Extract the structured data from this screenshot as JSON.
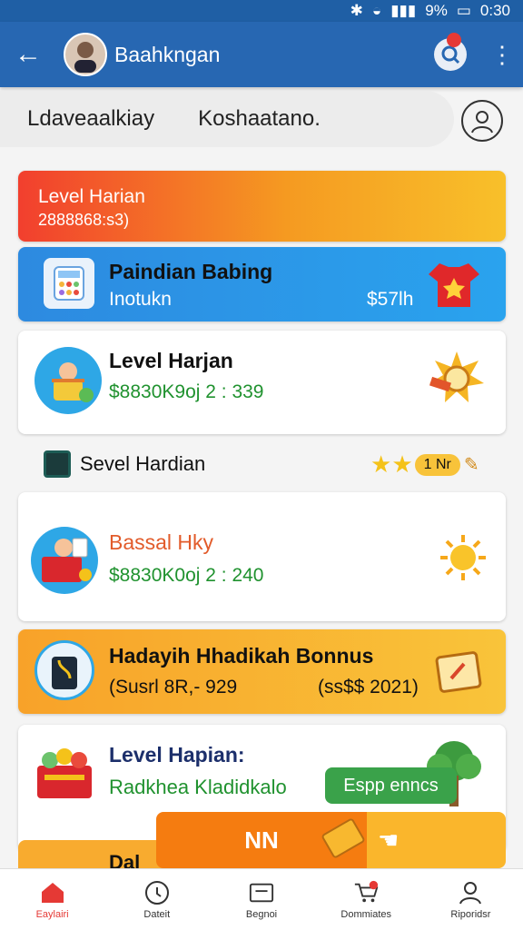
{
  "status": {
    "battery": "9%",
    "time": "0:30"
  },
  "header": {
    "title": "Baahkngan"
  },
  "search": {
    "left": "Ldaveaalkiay",
    "right": "Koshaatano."
  },
  "cards": [
    {
      "title": "Level Harian",
      "subtitle": "2888868:s3)"
    },
    {
      "title": "Paindian Babing",
      "subtitle": "Inotukn",
      "amount": "$57lh"
    },
    {
      "title": "Level Harjan",
      "subtitle": "$8830K9oj 2 : 339"
    },
    {
      "title": "Bassal Hky",
      "subtitle": "$8830K0oj 2 : 240"
    },
    {
      "title": "Hadayih Hhadikah Bonnus",
      "subtitle": "(Susrl 8R,- 929",
      "amount": "(ss$$ 2021)"
    },
    {
      "title": "Level Hapian:",
      "subtitle": "Radkhea Kladidkalo"
    }
  ],
  "section": {
    "label": "Sevel Hardian",
    "badge": "1 Nr"
  },
  "green_button": {
    "label": "Espp enncs"
  },
  "floating_button": {
    "label": "NN"
  },
  "peek_card": {
    "title": "Dal"
  },
  "bottom_nav": [
    {
      "label": "Eaylairi",
      "icon": "home-icon"
    },
    {
      "label": "Dateit",
      "icon": "clock-icon"
    },
    {
      "label": "Begnoi",
      "icon": "card-icon"
    },
    {
      "label": "Dommiates",
      "icon": "cart-icon"
    },
    {
      "label": "Riporidsr",
      "icon": "user-icon"
    }
  ],
  "colors": {
    "appbar": "#2767b2",
    "accent": "#f57c10",
    "green": "#20922f"
  }
}
